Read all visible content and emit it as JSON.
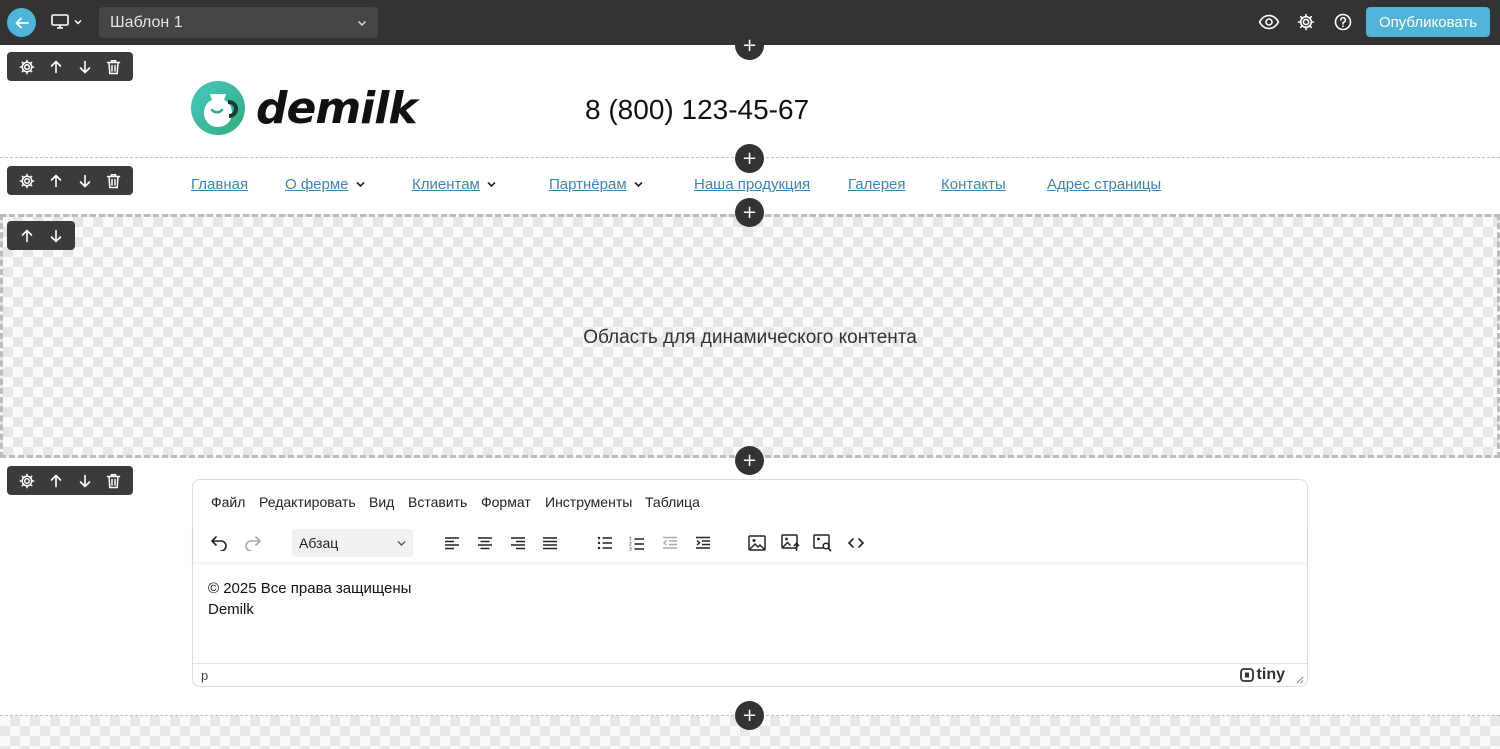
{
  "topbar": {
    "template_name": "Шаблон 1",
    "publish_label": "Опубликовать",
    "icons": [
      "back-arrow-icon",
      "desktop-icon",
      "chevron-down-icon",
      "eye-icon",
      "gear-icon",
      "help-icon"
    ],
    "accent_color": "#4fb4d8"
  },
  "header": {
    "logo_text": "demilk",
    "phone": "8 (800) 123-45-67"
  },
  "menu": {
    "items": [
      {
        "label": "Главная",
        "dropdown": false
      },
      {
        "label": "О ферме",
        "dropdown": true
      },
      {
        "label": "Клиентам",
        "dropdown": true
      },
      {
        "label": "Партнёрам",
        "dropdown": true
      },
      {
        "label": "Наша продукция",
        "dropdown": false
      },
      {
        "label": "Галерея",
        "dropdown": false
      },
      {
        "label": "Контакты",
        "dropdown": false
      },
      {
        "label": "Адрес страницы",
        "dropdown": false
      }
    ],
    "link_color": "#3a86b8"
  },
  "dynamic": {
    "label": "Область для динамического контента"
  },
  "editor": {
    "menu": [
      "Файл",
      "Редактировать",
      "Вид",
      "Вставить",
      "Формат",
      "Инструменты",
      "Таблица"
    ],
    "block_format": "Абзац",
    "content_lines": [
      "© 2025 Все права защищены",
      "Demilk"
    ],
    "path": "p",
    "brand": "tiny"
  },
  "plus_label": "+"
}
